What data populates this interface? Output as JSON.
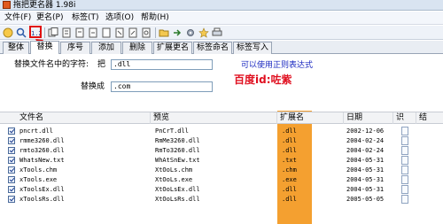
{
  "window": {
    "title": "拖把更名器 1.98i"
  },
  "menu": [
    {
      "label": "文件(F)"
    },
    {
      "label": "更名(P)"
    },
    {
      "label": "标签(T)"
    },
    {
      "label": "选项(O)"
    },
    {
      "label": "帮助(H)"
    }
  ],
  "toolbar": {
    "icons": [
      "open-icon",
      "search-icon",
      "replace-icon",
      "copy-icon",
      "doc-icon",
      "doc-icon",
      "doc-icon",
      "doc-icon",
      "doc-icon",
      "doc-icon",
      "folder-icon",
      "arrow-icon",
      "gear-icon",
      "star-icon",
      "print-icon"
    ]
  },
  "tabs": [
    {
      "label": "整体"
    },
    {
      "label": "替换"
    },
    {
      "label": "序号"
    },
    {
      "label": "添加"
    },
    {
      "label": "删除"
    },
    {
      "label": "扩展更名"
    },
    {
      "label": "标签命名"
    },
    {
      "label": "标签写入"
    }
  ],
  "replace_panel": {
    "find_label": "替换文件名中的字符:",
    "find_prefix": "把",
    "find_value": ".dll",
    "replace_label": "替换成",
    "replace_value": ".com",
    "regex_tip": "可以使用正则表达式",
    "watermark": "百度id:咗紫"
  },
  "table": {
    "headers": {
      "filename": "文件名",
      "preview": "预览",
      "ext": "扩展名",
      "date": "日期",
      "attr": "识",
      "result": "结"
    },
    "rows": [
      {
        "name": "pncrt.dll",
        "preview": "PnCrT.dll",
        "ext": ".dll",
        "date": "2002-12-06"
      },
      {
        "name": "rmme3260.dll",
        "preview": "RmMe3260.dll",
        "ext": ".dll",
        "date": "2004-02-24"
      },
      {
        "name": "rmto3260.dll",
        "preview": "RmTo3260.dll",
        "ext": ".dll",
        "date": "2004-02-24"
      },
      {
        "name": "WhatsNew.txt",
        "preview": "WhAtSnEw.txt",
        "ext": ".txt",
        "date": "2004-05-31"
      },
      {
        "name": "xTools.chm",
        "preview": "XtOoLs.chm",
        "ext": ".chm",
        "date": "2004-05-31"
      },
      {
        "name": "xTools.exe",
        "preview": "XtOoLs.exe",
        "ext": ".exe",
        "date": "2004-05-31"
      },
      {
        "name": "xToolsEx.dll",
        "preview": "XtOoLsEx.dll",
        "ext": ".dll",
        "date": "2004-05-31"
      },
      {
        "name": "xToolsRs.dll",
        "preview": "XtOoLsRs.dll",
        "ext": ".dll",
        "date": "2005-05-05"
      }
    ]
  },
  "colors": {
    "highlight": "#f4a030",
    "arrow": "#e01010",
    "regex_tip": "#1a28c0",
    "watermark": "#e01020"
  }
}
